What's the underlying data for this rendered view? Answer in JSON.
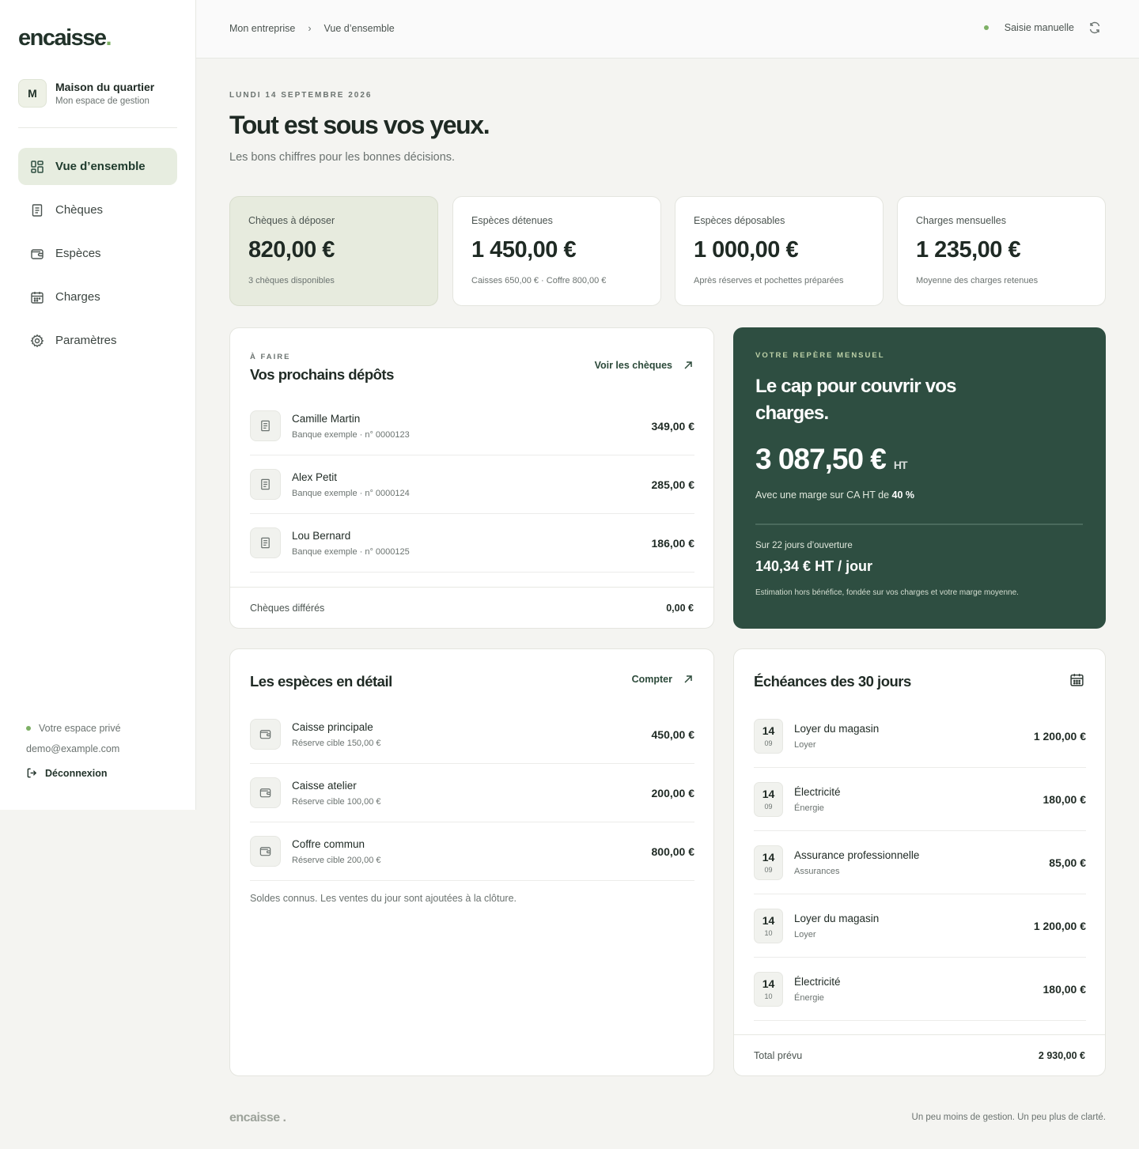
{
  "sidebar": {
    "logo": "encaisse",
    "logo_dot": ".",
    "org": {
      "initial": "M",
      "name": "Maison du quartier",
      "sub": "Mon espace de gestion"
    },
    "nav": [
      {
        "label": "Vue d’ensemble",
        "icon": "dashboard-icon",
        "active": true
      },
      {
        "label": "Chèques",
        "icon": "receipt-icon",
        "active": false
      },
      {
        "label": "Espèces",
        "icon": "wallet-icon",
        "active": false
      },
      {
        "label": "Charges",
        "icon": "calendar-icon",
        "active": false
      },
      {
        "label": "Paramètres",
        "icon": "gear-icon",
        "active": false
      }
    ],
    "private_label": "Votre espace privé",
    "email": "demo@example.com",
    "logout": "Déconnexion"
  },
  "topbar": {
    "breadcrumb": [
      "Mon entreprise",
      "Vue d’ensemble"
    ],
    "breadcrumb_sep": "›",
    "status": "Saisie manuelle"
  },
  "header": {
    "date": "LUNDI 14 SEPTEMBRE 2026",
    "title": "Tout est sous vos yeux.",
    "subtitle": "Les bons chiffres pour les bonnes décisions."
  },
  "stats": [
    {
      "label": "Chèques à déposer",
      "value": "820,00 €",
      "sub": "3 chèques disponibles"
    },
    {
      "label": "Espèces détenues",
      "value": "1 450,00 €",
      "sub": "Caisses 650,00 € · Coffre 800,00 €"
    },
    {
      "label": "Espèces déposables",
      "value": "1 000,00 €",
      "sub": "Après réserves et pochettes préparées"
    },
    {
      "label": "Charges mensuelles",
      "value": "1 235,00 €",
      "sub": "Moyenne des charges retenues"
    }
  ],
  "deposits": {
    "eyebrow": "À FAIRE",
    "title": "Vos prochains dépôts",
    "link": "Voir les chèques",
    "rows": [
      {
        "name": "Camille Martin",
        "meta": "Banque exemple · n° 0000123",
        "amount": "349,00 €"
      },
      {
        "name": "Alex Petit",
        "meta": "Banque exemple · n° 0000124",
        "amount": "285,00 €"
      },
      {
        "name": "Lou Bernard",
        "meta": "Banque exemple · n° 0000125",
        "amount": "186,00 €"
      }
    ],
    "footer_label": "Chèques différés",
    "footer_value": "0,00 €"
  },
  "monthly": {
    "eyebrow": "VOTRE REPÈRE MENSUEL",
    "title": "Le cap pour couvrir vos charges.",
    "value": "3 087,50 €",
    "unit": "HT",
    "margin_text": "Avec une marge sur CA HT de ",
    "margin_value": "40 %",
    "days": "Sur 22 jours d’ouverture",
    "per_day": "140,34 € HT / jour",
    "note": "Estimation hors bénéfice, fondée sur vos charges et votre marge moyenne."
  },
  "cash": {
    "title": "Les espèces en détail",
    "link": "Compter",
    "rows": [
      {
        "name": "Caisse principale",
        "meta": "Réserve cible 150,00 €",
        "amount": "450,00 €"
      },
      {
        "name": "Caisse atelier",
        "meta": "Réserve cible 100,00 €",
        "amount": "200,00 €"
      },
      {
        "name": "Coffre commun",
        "meta": "Réserve cible 200,00 €",
        "amount": "800,00 €"
      }
    ],
    "note": "Soldes connus. Les ventes du jour sont ajoutées à la clôture."
  },
  "dues": {
    "title": "Échéances des 30 jours",
    "rows": [
      {
        "day": "14",
        "month": "09",
        "name": "Loyer du magasin",
        "cat": "Loyer",
        "amount": "1 200,00 €"
      },
      {
        "day": "14",
        "month": "09",
        "name": "Électricité",
        "cat": "Énergie",
        "amount": "180,00 €"
      },
      {
        "day": "14",
        "month": "09",
        "name": "Assurance professionnelle",
        "cat": "Assurances",
        "amount": "85,00 €"
      },
      {
        "day": "14",
        "month": "10",
        "name": "Loyer du magasin",
        "cat": "Loyer",
        "amount": "1 200,00 €"
      },
      {
        "day": "14",
        "month": "10",
        "name": "Électricité",
        "cat": "Énergie",
        "amount": "180,00 €"
      }
    ],
    "footer_label": "Total prévu",
    "footer_value": "2 930,00 €"
  },
  "footer": {
    "logo": "encaisse .",
    "tagline": "Un peu moins de gestion. Un peu plus de clarté."
  },
  "colors": {
    "accent": "#7db065",
    "dark_green": "#2e4e41",
    "highlight": "#e7ebde"
  }
}
